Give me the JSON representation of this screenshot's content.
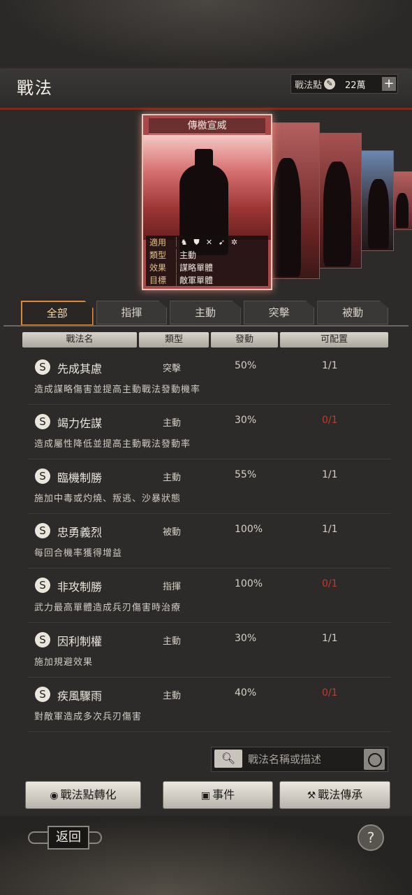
{
  "header": {
    "title": "戰法",
    "points_label": "戰法點",
    "points_value": "22萬",
    "add_label": "+"
  },
  "featured_card": {
    "name": "傳檄宣威",
    "rows": [
      {
        "key": "適用",
        "value": ""
      },
      {
        "key": "類型",
        "value": "主動"
      },
      {
        "key": "效果",
        "value": "謀略單體"
      },
      {
        "key": "目標",
        "value": "敵軍單體"
      }
    ],
    "unit_icons": [
      "cavalry-icon",
      "shield-icon",
      "bow-icon",
      "spear-icon",
      "wheel-icon"
    ]
  },
  "tabs": [
    {
      "label": "全部",
      "active": true
    },
    {
      "label": "指揮",
      "active": false
    },
    {
      "label": "主動",
      "active": false
    },
    {
      "label": "突擊",
      "active": false
    },
    {
      "label": "被動",
      "active": false
    }
  ],
  "columns": [
    "戰法名",
    "類型",
    "發動",
    "可配置"
  ],
  "tactics": [
    {
      "grade": "S",
      "name": "先成其慮",
      "type": "突擊",
      "rate": "50%",
      "config": "1/1",
      "config_color": "#d6d0c4",
      "desc": "造成謀略傷害並提高主動戰法發動機率"
    },
    {
      "grade": "S",
      "name": "竭力佐謀",
      "type": "主動",
      "rate": "30%",
      "config": "0/1",
      "config_color": "#c23a2a",
      "desc": "造成屬性降低並提高主動戰法發動率"
    },
    {
      "grade": "S",
      "name": "臨機制勝",
      "type": "主動",
      "rate": "55%",
      "config": "1/1",
      "config_color": "#d6d0c4",
      "desc": "施加中毒或灼燒、叛逃、沙暴狀態"
    },
    {
      "grade": "S",
      "name": "忠勇義烈",
      "type": "被動",
      "rate": "100%",
      "config": "1/1",
      "config_color": "#d6d0c4",
      "desc": "每回合機率獲得增益"
    },
    {
      "grade": "S",
      "name": "非攻制勝",
      "type": "指揮",
      "rate": "100%",
      "config": "0/1",
      "config_color": "#c23a2a",
      "desc": "武力最高單體造成兵刃傷害時治療"
    },
    {
      "grade": "S",
      "name": "因利制權",
      "type": "主動",
      "rate": "30%",
      "config": "1/1",
      "config_color": "#d6d0c4",
      "desc": "施加規避效果"
    },
    {
      "grade": "S",
      "name": "疾風驟雨",
      "type": "主動",
      "rate": "40%",
      "config": "0/1",
      "config_color": "#c23a2a",
      "desc": "對敵軍造成多次兵刃傷害"
    }
  ],
  "search": {
    "placeholder": "戰法名稱或描述"
  },
  "buttons": {
    "convert": "戰法點轉化",
    "event": "事件",
    "inherit": "戰法傳承"
  },
  "footer": {
    "back": "返回",
    "help": "?"
  }
}
